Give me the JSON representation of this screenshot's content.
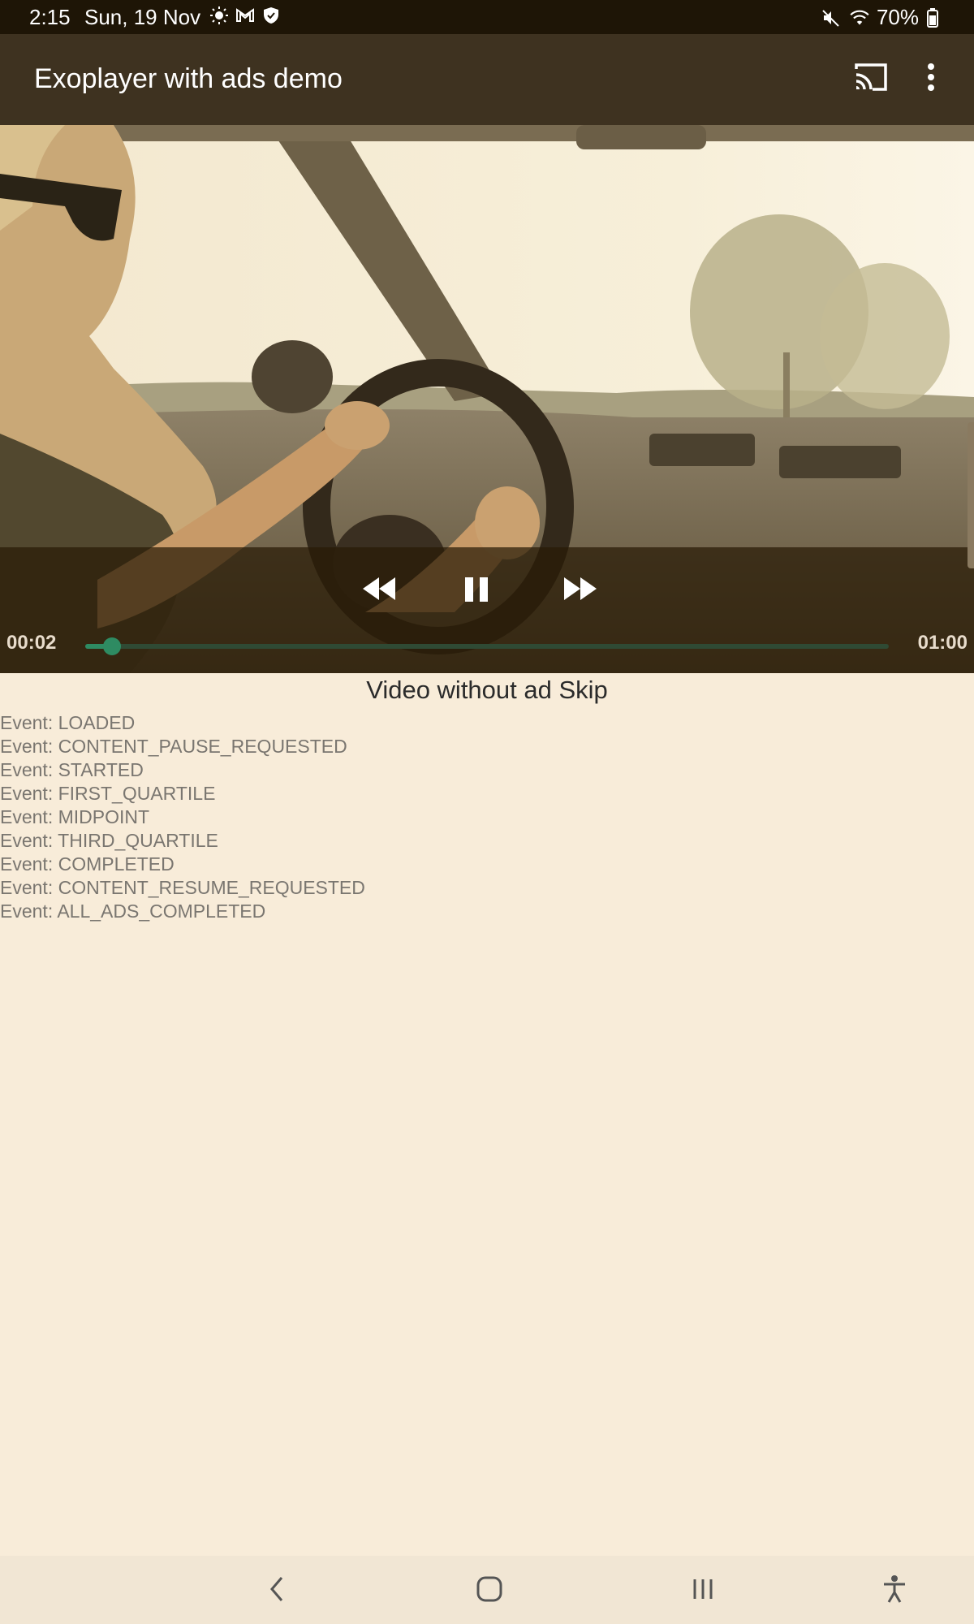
{
  "status_bar": {
    "time": "2:15",
    "date": "Sun, 19 Nov",
    "left_icons": [
      "brightness-icon",
      "gmail-icon",
      "shield-icon"
    ],
    "right_icons": [
      "mute-icon",
      "wifi-icon"
    ],
    "battery": "70%"
  },
  "app_bar": {
    "title": "Exoplayer with ads demo",
    "cast_icon": "cast-icon",
    "menu_icon": "more-vert-icon",
    "background": "#3e3220"
  },
  "player": {
    "current_time": "00:02",
    "duration": "01:00",
    "progress_fraction": 0.033,
    "controls": [
      "rewind-icon",
      "pause-icon",
      "fast-forward-icon"
    ],
    "accent": "#2e8b62"
  },
  "main": {
    "caption": "Video without ad Skip",
    "events": [
      "Event: LOADED",
      "Event: CONTENT_PAUSE_REQUESTED",
      "Event: STARTED",
      "Event: FIRST_QUARTILE",
      "Event: MIDPOINT",
      "Event: THIRD_QUARTILE",
      "Event: COMPLETED",
      "Event: CONTENT_RESUME_REQUESTED",
      "Event: ALL_ADS_COMPLETED"
    ]
  },
  "nav_bar": {
    "buttons": [
      "back-icon",
      "home-icon",
      "recents-icon",
      "accessibility-icon"
    ]
  },
  "colors": {
    "page_background": "#f8ecd9",
    "status_bar": "#1e1506"
  }
}
